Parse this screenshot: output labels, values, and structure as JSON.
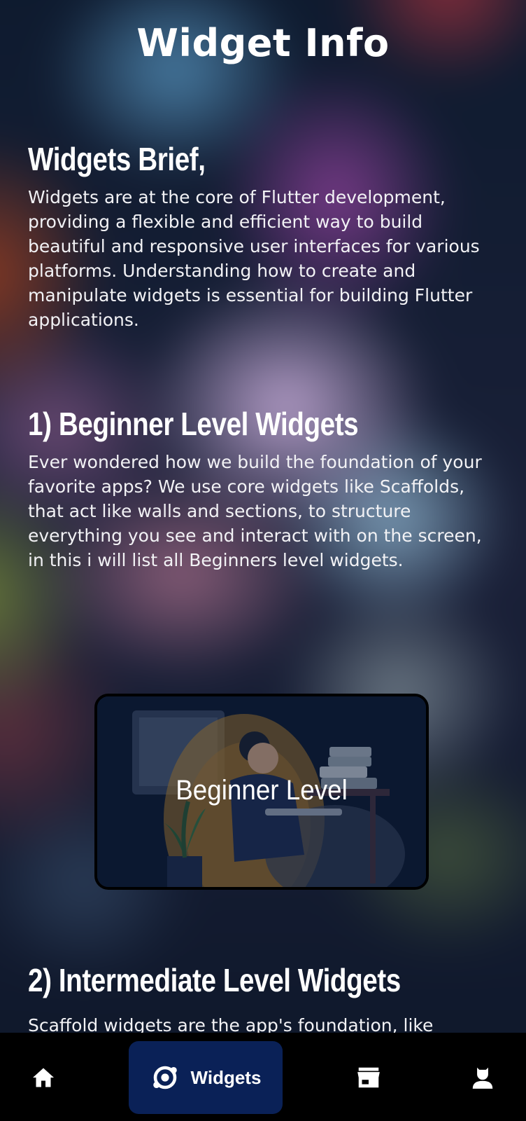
{
  "app": {
    "title": "Widget Info"
  },
  "sections": [
    {
      "heading": "Widgets Brief,",
      "text": "Widgets are at the core of Flutter development, providing a flexible and efficient way to build beautiful and responsive user interfaces for various platforms. Understanding how to create and manipulate widgets is essential for building Flutter applications."
    },
    {
      "heading": "1) Beginner Level Widgets",
      "text": "Ever wondered how we build the foundation of your favorite apps? We use core widgets like Scaffolds, that act like walls and sections, to structure everything you see and interact with on the screen, in this i will list all Beginners level widgets."
    },
    {
      "heading": "2) Intermediate Level Widgets",
      "text": "Scaffold widgets are the app's foundation, like"
    }
  ],
  "level_card": {
    "label": "Beginner Level"
  },
  "bottom_nav": {
    "items": [
      {
        "icon": "home-icon",
        "label": ""
      },
      {
        "icon": "widgets-icon",
        "label": "Widgets"
      },
      {
        "icon": "store-icon",
        "label": ""
      },
      {
        "icon": "person-icon",
        "label": ""
      }
    ],
    "active_bg": "#0a2157"
  },
  "colors": {
    "text": "#ffffff",
    "nav_background": "#000000"
  }
}
